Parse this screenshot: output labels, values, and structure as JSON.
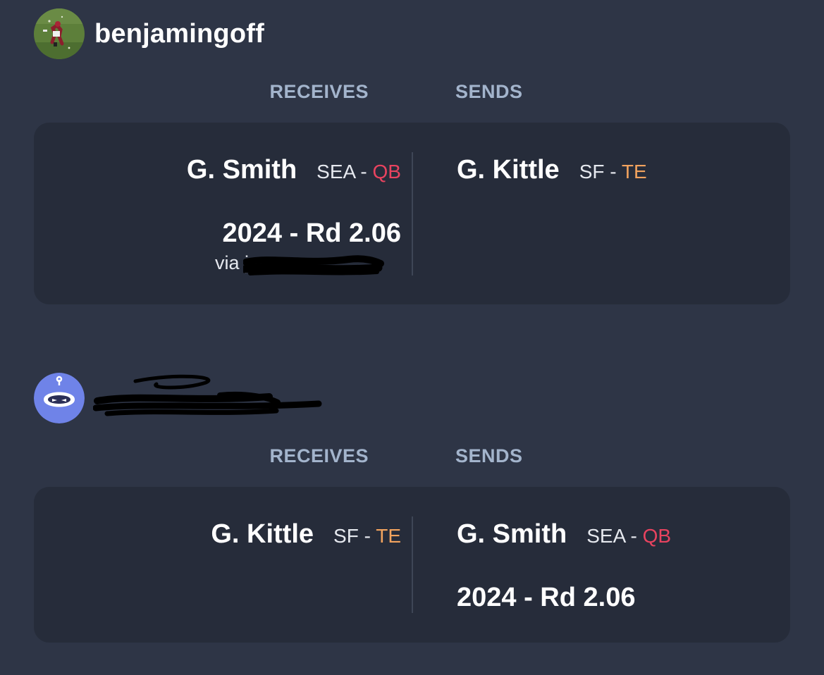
{
  "trades": [
    {
      "username": "benjamingoff",
      "avatar_icon": "football-player-photo-avatar",
      "headers": {
        "receives": "RECEIVES",
        "sends": "SENDS"
      },
      "receives": {
        "player": {
          "name": "G. Smith",
          "team": "SEA",
          "dash": "-",
          "position": "QB"
        },
        "pick": {
          "label": "2024 - Rd 2.06",
          "via": "via j"
        }
      },
      "sends": {
        "player": {
          "name": "G. Kittle",
          "team": "SF",
          "dash": "-",
          "position": "TE"
        }
      }
    },
    {
      "username": "",
      "avatar_icon": "robot-avatar-icon",
      "headers": {
        "receives": "RECEIVES",
        "sends": "SENDS"
      },
      "receives": {
        "player": {
          "name": "G. Kittle",
          "team": "SF",
          "dash": "-",
          "position": "TE"
        }
      },
      "sends": {
        "player": {
          "name": "G. Smith",
          "team": "SEA",
          "dash": "-",
          "position": "QB"
        },
        "pick": {
          "label": "2024 - Rd 2.06"
        }
      }
    }
  ],
  "colors": {
    "background": "#2e3546",
    "card": "#262c3a",
    "header": "#a3b4cc",
    "qb": "#e8435f",
    "te": "#f2a35e"
  }
}
